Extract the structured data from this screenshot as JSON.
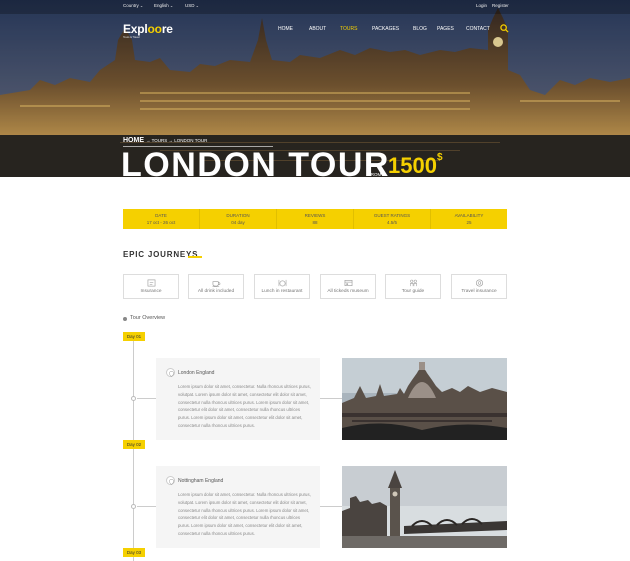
{
  "topbar": {
    "country": "Country",
    "language": "English",
    "currency": "USD",
    "login": "Login",
    "register": "Register"
  },
  "logo": {
    "pre": "Expl",
    "oo": "oo",
    "post": "re",
    "tagline": "Tours & Travel"
  },
  "nav": [
    "HOME",
    "ABOUT",
    "TOURS",
    "PACKAGES",
    "BLOG",
    "PAGES",
    "CONTACT"
  ],
  "nav_active": "TOURS",
  "breadcrumb": {
    "home": "HOME",
    "trail": "→ TOURS → LONDON TOUR"
  },
  "hero": {
    "title": "LONDON TOUR",
    "from": "FROM",
    "price": "1500",
    "currency_symbol": "$"
  },
  "infobar": [
    {
      "label": "DATE",
      "value": "17 oct - 26 oct"
    },
    {
      "label": "DURATION",
      "value": "04 day"
    },
    {
      "label": "REVIEWS",
      "value": "88"
    },
    {
      "label": "GUEST RATINGS",
      "value": "4.5/5"
    },
    {
      "label": "AVAILABILITY",
      "value": "25"
    }
  ],
  "section_title": "EPIC JOURNEYS",
  "features": [
    {
      "label": "Insurance",
      "icon": "insurance-icon"
    },
    {
      "label": "All drink included",
      "icon": "cup-icon"
    },
    {
      "label": "Lunch in restaurant",
      "icon": "dining-icon"
    },
    {
      "label": "All tickeds museum",
      "icon": "ticket-icon"
    },
    {
      "label": "Tour guide",
      "icon": "guide-icon"
    },
    {
      "label": "Travel insurance",
      "icon": "lifebuoy-icon"
    }
  ],
  "overview_title": "Tour Overview",
  "days": [
    "Day 01",
    "Day 02",
    "Day 03"
  ],
  "itinerary": [
    {
      "place": "London England",
      "text": "Lorem ipsum dolor sit amet, consectetur. Nulla rhoncus ultrices purus, volutpat. Lorem ipsum dolor sit amet, consectetur elit dolor sit amet, consectetur nulla rhoncus ultrices purus. Lorem ipsum dolor sit amet, consectetur elit dolor sit amet, consectetur nulla rhoncus ultrices purus. Lorem ipsum dolor sit amet, consectetur elit dolor sit amet, consectetur nulla rhoncus ultrices purus."
    },
    {
      "place": "Nottingham England",
      "text": "Lorem ipsum dolor sit amet, consectetur. Nulla rhoncus ultrices purus, volutpat. Lorem ipsum dolor sit amet, consectetur elit dolor sit amet, consectetur nulla rhoncus ultrices purus. Lorem ipsum dolor sit amet, consectetur elit dolor sit amet, consectetur nulla rhoncus ultrices purus. Lorem ipsum dolor sit amet, consectetur elit dolor sit amet, consectetur nulla rhoncus ultrices purus."
    }
  ],
  "colors": {
    "accent": "#f5d000",
    "text": "#444444",
    "muted": "#888888"
  }
}
